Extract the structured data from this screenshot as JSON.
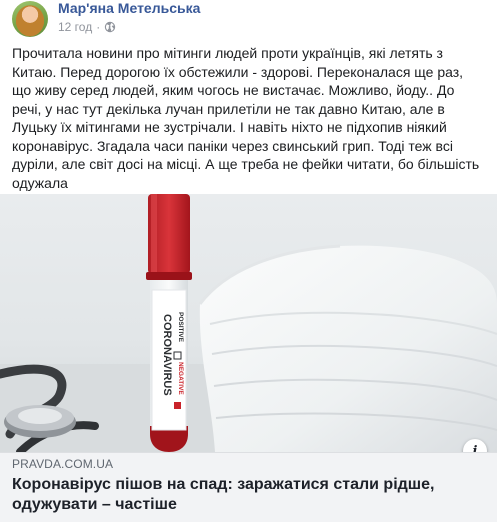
{
  "post": {
    "author": "Мар'яна Метельська",
    "time": "12 год",
    "time_separator": "·",
    "text": "Прочитала новини про мітинги людей проти українців, які летять з Китаю. Перед дорогою їх обстежили - здорові. Переконалася ще раз, що живу серед людей, яким чогось не вистачає. Можливо, йоду.. До речі, у нас тут декілька лучан прилетіли не так давно Китаю, але в Луцьку їх мітингами не зустрічали. І навіть ніхто не підхопив ніякий коронавірус. Згадала часи паніки через свинський грип. Тоді теж всі дуріли, але світ досі на місці. А ще треба не фейки читати, бо більшість одужала"
  },
  "link": {
    "domain": "PRAVDA.COM.UA",
    "title": "Коронавірус пішов на спад: заражатися стали рідше, одужувати – частіше",
    "image_text": {
      "tube_main": "CORONAVIRUS",
      "positive": "POSITIVE",
      "negative": "NEGATIVE"
    },
    "info_icon": "i"
  },
  "colors": {
    "author": "#385898",
    "meta": "#90949c",
    "link_bg": "#f2f3f5",
    "tube_cap": "#c9232a",
    "blood": "#a1141b"
  },
  "icons": [
    "globe-icon",
    "info-icon"
  ]
}
